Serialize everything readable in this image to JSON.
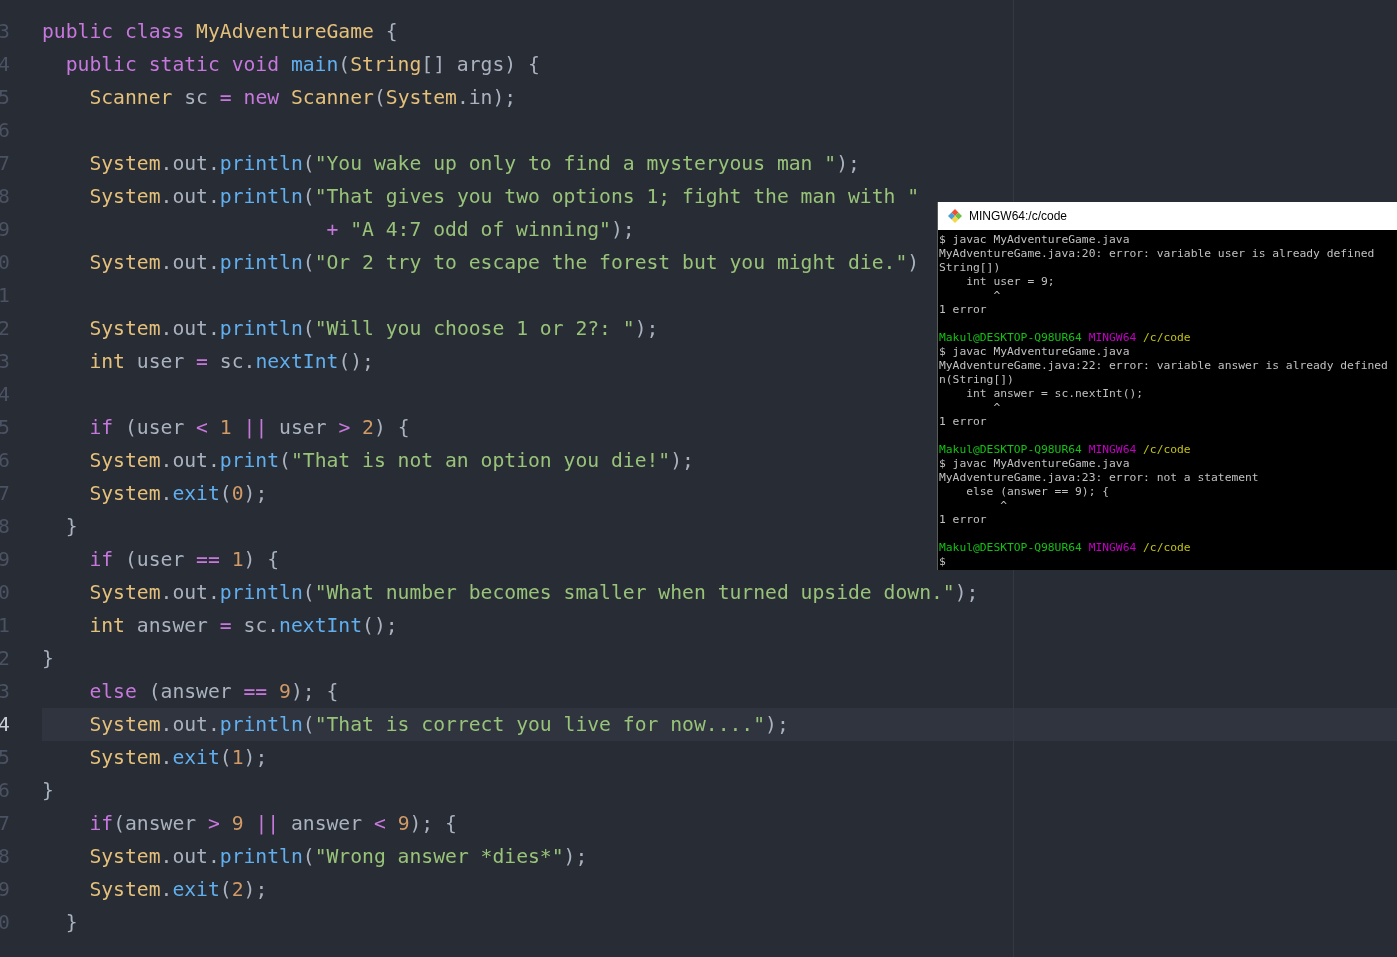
{
  "editor": {
    "lines": [
      {
        "number": "3",
        "current": false,
        "tokens": [
          {
            "text": "public",
            "kind": "keyword"
          },
          {
            "text": " class",
            "kind": "keyword"
          },
          {
            "text": " MyAdventureGame",
            "kind": "type"
          },
          {
            "text": " {",
            "kind": "plain"
          }
        ]
      },
      {
        "number": "4",
        "current": false,
        "tokens": [
          {
            "text": "  public static void",
            "kind": "keyword"
          },
          {
            "text": " main",
            "kind": "function"
          },
          {
            "text": "(",
            "kind": "plain"
          },
          {
            "text": "String",
            "kind": "type"
          },
          {
            "text": "[] args) {",
            "kind": "plain"
          }
        ]
      },
      {
        "number": "5",
        "current": false,
        "tokens": [
          {
            "text": "    Scanner",
            "kind": "type"
          },
          {
            "text": " sc ",
            "kind": "plain"
          },
          {
            "text": "=",
            "kind": "operator"
          },
          {
            "text": " new",
            "kind": "keyword"
          },
          {
            "text": " Scanner",
            "kind": "type"
          },
          {
            "text": "(",
            "kind": "plain"
          },
          {
            "text": "System",
            "kind": "type"
          },
          {
            "text": ".in);",
            "kind": "plain"
          }
        ]
      },
      {
        "number": "6",
        "current": false
      },
      {
        "number": "7",
        "current": false,
        "tokens": [
          {
            "text": "    System",
            "kind": "type"
          },
          {
            "text": ".out.",
            "kind": "plain"
          },
          {
            "text": "println",
            "kind": "function"
          },
          {
            "text": "(",
            "kind": "plain"
          },
          {
            "text": "\"You wake up only to find a mysteryous man \"",
            "kind": "string"
          },
          {
            "text": ");",
            "kind": "plain"
          }
        ]
      },
      {
        "number": "8",
        "current": false,
        "tokens": [
          {
            "text": "    System",
            "kind": "type"
          },
          {
            "text": ".out.",
            "kind": "plain"
          },
          {
            "text": "println",
            "kind": "function"
          },
          {
            "text": "(",
            "kind": "plain"
          },
          {
            "text": "\"That gives you two options 1; fight the man with \"",
            "kind": "string"
          }
        ]
      },
      {
        "number": "9",
        "current": false,
        "tokens": [
          {
            "text": "                        +",
            "kind": "operator"
          },
          {
            "text": " \"A 4:7 odd of winning\"",
            "kind": "string"
          },
          {
            "text": ");",
            "kind": "plain"
          }
        ]
      },
      {
        "number": "0",
        "current": false,
        "tokens": [
          {
            "text": "    System",
            "kind": "type"
          },
          {
            "text": ".out.",
            "kind": "plain"
          },
          {
            "text": "println",
            "kind": "function"
          },
          {
            "text": "(",
            "kind": "plain"
          },
          {
            "text": "\"Or 2 try to escape the forest but you might die.\"",
            "kind": "string"
          },
          {
            "text": ")",
            "kind": "plain"
          }
        ]
      },
      {
        "number": "1",
        "current": false
      },
      {
        "number": "2",
        "current": false,
        "tokens": [
          {
            "text": "    System",
            "kind": "type"
          },
          {
            "text": ".out.",
            "kind": "plain"
          },
          {
            "text": "println",
            "kind": "function"
          },
          {
            "text": "(",
            "kind": "plain"
          },
          {
            "text": "\"Will you choose 1 or 2?: \"",
            "kind": "string"
          },
          {
            "text": ");",
            "kind": "plain"
          }
        ]
      },
      {
        "number": "3",
        "current": false,
        "tokens": [
          {
            "text": "    int",
            "kind": "type"
          },
          {
            "text": " user ",
            "kind": "plain"
          },
          {
            "text": "=",
            "kind": "operator"
          },
          {
            "text": " sc.",
            "kind": "plain"
          },
          {
            "text": "nextInt",
            "kind": "function"
          },
          {
            "text": "();",
            "kind": "plain"
          }
        ]
      },
      {
        "number": "4",
        "current": false
      },
      {
        "number": "5",
        "current": false,
        "tokens": [
          {
            "text": "    if",
            "kind": "keyword"
          },
          {
            "text": " (user ",
            "kind": "plain"
          },
          {
            "text": "<",
            "kind": "operator"
          },
          {
            "text": " 1",
            "kind": "number"
          },
          {
            "text": " ||",
            "kind": "operator"
          },
          {
            "text": " user ",
            "kind": "plain"
          },
          {
            "text": ">",
            "kind": "operator"
          },
          {
            "text": " 2",
            "kind": "number"
          },
          {
            "text": ") {",
            "kind": "plain"
          }
        ]
      },
      {
        "number": "6",
        "current": false,
        "tokens": [
          {
            "text": "    System",
            "kind": "type"
          },
          {
            "text": ".out.",
            "kind": "plain"
          },
          {
            "text": "print",
            "kind": "function"
          },
          {
            "text": "(",
            "kind": "plain"
          },
          {
            "text": "\"That is not an option you die!\"",
            "kind": "string"
          },
          {
            "text": ");",
            "kind": "plain"
          }
        ]
      },
      {
        "number": "7",
        "current": false,
        "tokens": [
          {
            "text": "    System",
            "kind": "type"
          },
          {
            "text": ".",
            "kind": "plain"
          },
          {
            "text": "exit",
            "kind": "function"
          },
          {
            "text": "(",
            "kind": "plain"
          },
          {
            "text": "0",
            "kind": "number"
          },
          {
            "text": ");",
            "kind": "plain"
          }
        ]
      },
      {
        "number": "8",
        "current": false,
        "tokens": [
          {
            "text": "  }",
            "kind": "plain"
          }
        ]
      },
      {
        "number": "9",
        "current": false,
        "tokens": [
          {
            "text": "    if",
            "kind": "keyword"
          },
          {
            "text": " (user ",
            "kind": "plain"
          },
          {
            "text": "==",
            "kind": "operator"
          },
          {
            "text": " 1",
            "kind": "number"
          },
          {
            "text": ") {",
            "kind": "plain"
          }
        ]
      },
      {
        "number": "0",
        "current": false,
        "tokens": [
          {
            "text": "    System",
            "kind": "type"
          },
          {
            "text": ".out.",
            "kind": "plain"
          },
          {
            "text": "println",
            "kind": "function"
          },
          {
            "text": "(",
            "kind": "plain"
          },
          {
            "text": "\"What number becomes smaller when turned upside down.\"",
            "kind": "string"
          },
          {
            "text": ");",
            "kind": "plain"
          }
        ]
      },
      {
        "number": "1",
        "current": false,
        "tokens": [
          {
            "text": "    int",
            "kind": "type"
          },
          {
            "text": " answer ",
            "kind": "plain"
          },
          {
            "text": "=",
            "kind": "operator"
          },
          {
            "text": " sc.",
            "kind": "plain"
          },
          {
            "text": "nextInt",
            "kind": "function"
          },
          {
            "text": "();",
            "kind": "plain"
          }
        ]
      },
      {
        "number": "2",
        "current": false,
        "tokens": [
          {
            "text": "}",
            "kind": "plain"
          }
        ]
      },
      {
        "number": "3",
        "current": false,
        "tokens": [
          {
            "text": "    else",
            "kind": "keyword"
          },
          {
            "text": " (answer ",
            "kind": "plain"
          },
          {
            "text": "==",
            "kind": "operator"
          },
          {
            "text": " 9",
            "kind": "number"
          },
          {
            "text": "); {",
            "kind": "plain"
          }
        ]
      },
      {
        "number": "4",
        "current": true,
        "tokens": [
          {
            "text": "    System",
            "kind": "type"
          },
          {
            "text": ".out.",
            "kind": "plain"
          },
          {
            "text": "println",
            "kind": "function"
          },
          {
            "text": "(",
            "kind": "plain"
          },
          {
            "text": "\"That is correct you live for now....\"",
            "kind": "string"
          },
          {
            "text": ");",
            "kind": "plain"
          }
        ]
      },
      {
        "number": "5",
        "current": false,
        "tokens": [
          {
            "text": "    System",
            "kind": "type"
          },
          {
            "text": ".",
            "kind": "plain"
          },
          {
            "text": "exit",
            "kind": "function"
          },
          {
            "text": "(",
            "kind": "plain"
          },
          {
            "text": "1",
            "kind": "number"
          },
          {
            "text": ");",
            "kind": "plain"
          }
        ]
      },
      {
        "number": "6",
        "current": false,
        "tokens": [
          {
            "text": "}",
            "kind": "plain"
          }
        ]
      },
      {
        "number": "7",
        "current": false,
        "tokens": [
          {
            "text": "    if",
            "kind": "keyword"
          },
          {
            "text": "(answer ",
            "kind": "plain"
          },
          {
            "text": ">",
            "kind": "operator"
          },
          {
            "text": " 9",
            "kind": "number"
          },
          {
            "text": " ||",
            "kind": "operator"
          },
          {
            "text": " answer ",
            "kind": "plain"
          },
          {
            "text": "<",
            "kind": "operator"
          },
          {
            "text": " 9",
            "kind": "number"
          },
          {
            "text": "); {",
            "kind": "plain"
          }
        ]
      },
      {
        "number": "8",
        "current": false,
        "tokens": [
          {
            "text": "    System",
            "kind": "type"
          },
          {
            "text": ".out.",
            "kind": "plain"
          },
          {
            "text": "println",
            "kind": "function"
          },
          {
            "text": "(",
            "kind": "plain"
          },
          {
            "text": "\"Wrong answer *dies*\"",
            "kind": "string"
          },
          {
            "text": ");",
            "kind": "plain"
          }
        ]
      },
      {
        "number": "9",
        "current": false,
        "tokens": [
          {
            "text": "    System",
            "kind": "type"
          },
          {
            "text": ".",
            "kind": "plain"
          },
          {
            "text": "exit",
            "kind": "function"
          },
          {
            "text": "(",
            "kind": "plain"
          },
          {
            "text": "2",
            "kind": "number"
          },
          {
            "text": ");",
            "kind": "plain"
          }
        ]
      },
      {
        "number": "0",
        "current": false,
        "tokens": [
          {
            "text": "  }",
            "kind": "plain"
          }
        ]
      }
    ]
  },
  "terminal": {
    "title": "MINGW64:/c/code",
    "lines": [
      {
        "kind": "output",
        "text": "$ javac MyAdventureGame.java"
      },
      {
        "kind": "output",
        "text": "MyAdventureGame.java:20: error: variable user is already defined"
      },
      {
        "kind": "output",
        "text": "String[])"
      },
      {
        "kind": "output",
        "text": "    int user = 9;"
      },
      {
        "kind": "output",
        "text": "        ^"
      },
      {
        "kind": "output",
        "text": "1 error"
      },
      {
        "kind": "blank"
      },
      {
        "kind": "prompt",
        "user": "Makul@DESKTOP-Q98UR64",
        "system": "MINGW64",
        "path": "/c/code"
      },
      {
        "kind": "output",
        "text": "$ javac MyAdventureGame.java"
      },
      {
        "kind": "output",
        "text": "MyAdventureGame.java:22: error: variable answer is already defined"
      },
      {
        "kind": "output",
        "text": "n(String[])"
      },
      {
        "kind": "output",
        "text": "    int answer = sc.nextInt();"
      },
      {
        "kind": "output",
        "text": "        ^"
      },
      {
        "kind": "output",
        "text": "1 error"
      },
      {
        "kind": "blank"
      },
      {
        "kind": "prompt",
        "user": "Makul@DESKTOP-Q98UR64",
        "system": "MINGW64",
        "path": "/c/code"
      },
      {
        "kind": "output",
        "text": "$ javac MyAdventureGame.java"
      },
      {
        "kind": "output",
        "text": "MyAdventureGame.java:23: error: not a statement"
      },
      {
        "kind": "output",
        "text": "    else (answer == 9); {"
      },
      {
        "kind": "output",
        "text": "         ^"
      },
      {
        "kind": "output",
        "text": "1 error"
      },
      {
        "kind": "blank"
      },
      {
        "kind": "prompt",
        "user": "Makul@DESKTOP-Q98UR64",
        "system": "MINGW64",
        "path": "/c/code"
      },
      {
        "kind": "output",
        "text": "$"
      }
    ]
  }
}
